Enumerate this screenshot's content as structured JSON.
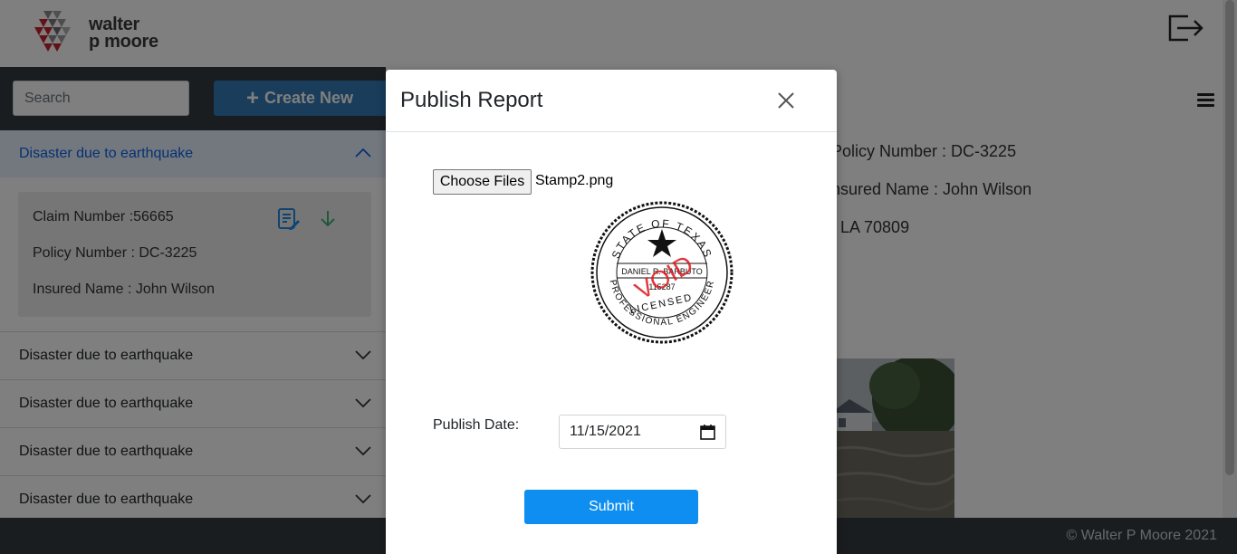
{
  "header": {
    "logo_line1": "walter",
    "logo_line2": "p moore"
  },
  "sidebar": {
    "search_placeholder": "Search",
    "create_label": "Create New",
    "items": [
      {
        "title": "Disaster due to earthquake",
        "expanded": true,
        "claim": {
          "claim_number": "Claim Number :56665",
          "policy_number": "Policy Number : DC-3225",
          "insured_name": "Insured Name : John Wilson"
        }
      },
      {
        "title": "Disaster due to earthquake",
        "expanded": false
      },
      {
        "title": "Disaster due to earthquake",
        "expanded": false
      },
      {
        "title": "Disaster due to earthquake",
        "expanded": false
      },
      {
        "title": "Disaster due to earthquake",
        "expanded": false
      }
    ]
  },
  "main": {
    "policy_number": "Policy Number : DC-3225",
    "insured_name": "nsured Name : John Wilson",
    "address": ", LA 70809"
  },
  "footer": {
    "copyright": "© Walter P Moore 2021"
  },
  "modal": {
    "title": "Publish Report",
    "file_button": "Choose Files",
    "file_name": "Stamp2.png",
    "stamp": {
      "top_text": "STATE OF TEXAS",
      "name": "DANIEL R. BARBUTO",
      "number": "115287",
      "licensed": "LICENSED",
      "bottom_text": "PROFESSIONAL ENGINEER",
      "void_text": "VOID"
    },
    "date_label": "Publish Date:",
    "date_value": "11/15/2021",
    "submit_label": "Submit"
  },
  "colors": {
    "accent": "#0d8ef0",
    "create_button": "#337ab7",
    "dark_bar": "#343a40",
    "logo_red": "#c8202f",
    "void_red": "#e0151b"
  }
}
